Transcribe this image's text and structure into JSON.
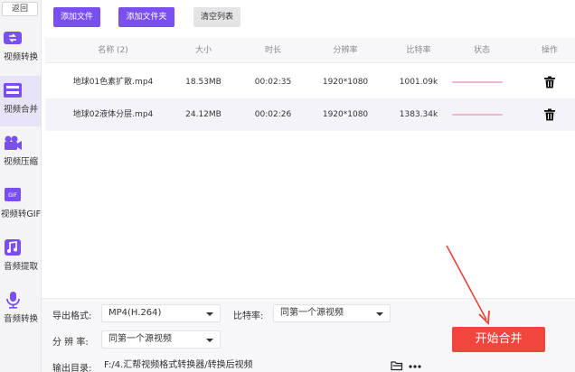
{
  "sidebar": {
    "back_label": "返回",
    "items": [
      {
        "label": "视频转换",
        "icon": "video-convert-icon"
      },
      {
        "label": "视频合并",
        "icon": "video-merge-icon",
        "active": true
      },
      {
        "label": "视频压缩",
        "icon": "video-compress-icon"
      },
      {
        "label": "视频转GIF",
        "icon": "gif-icon"
      },
      {
        "label": "音频提取",
        "icon": "music-note-icon"
      },
      {
        "label": "音频转换",
        "icon": "microphone-icon"
      }
    ]
  },
  "toolbar": {
    "add_file": "添加文件",
    "add_folder": "添加文件夹",
    "clear_list": "清空列表"
  },
  "table": {
    "columns": [
      "名称 (2)",
      "大小",
      "时长",
      "分辨率",
      "比特率",
      "状态",
      "操作"
    ],
    "rows": [
      {
        "name": "地球01色素扩散.mp4",
        "size": "18.53MB",
        "duration": "00:02:35",
        "resolution": "1920*1080",
        "bitrate": "1001.09k"
      },
      {
        "name": "地球02液体分层.mp4",
        "size": "24.12MB",
        "duration": "00:02:26",
        "resolution": "1920*1080",
        "bitrate": "1383.34k"
      }
    ]
  },
  "settings": {
    "format_label": "导出格式:",
    "format_value": "MP4(H.264)",
    "bitrate_label": "比特率:",
    "bitrate_value": "同第一个源视频",
    "resolution_label": "分 辨 率:",
    "resolution_value": "同第一个源视频",
    "output_label": "输出目录:",
    "output_path": "F:/4.汇帮视频格式转换器/转换后视频"
  },
  "start_button": "开始合并",
  "colors": {
    "accent": "#7a4ff0",
    "start": "#f2453d",
    "annotation_arrow": "#e8443a",
    "status_bar": "#f0b6c6"
  }
}
